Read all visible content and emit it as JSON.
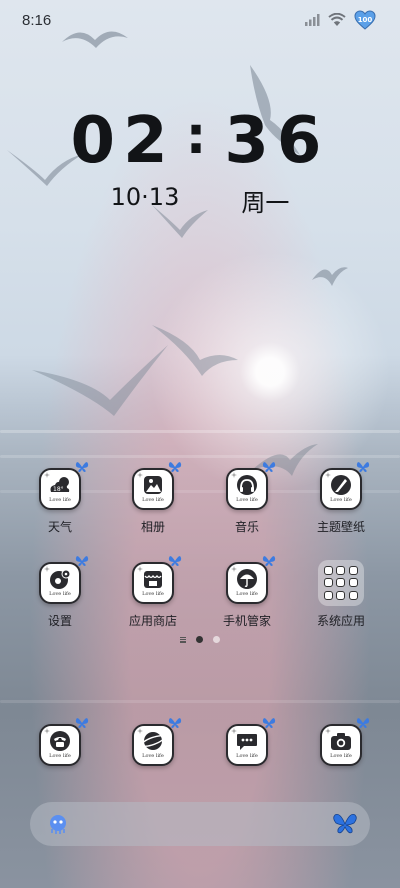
{
  "status_bar": {
    "time": "8:16",
    "battery_level": "100",
    "icons": [
      "signal-icon",
      "wifi-icon",
      "battery-heart-icon"
    ]
  },
  "clock": {
    "hours": "02",
    "separator": ":",
    "minutes": "36"
  },
  "date": {
    "day": "10·13",
    "weekday": "周一"
  },
  "icon_caption": "Love life",
  "apps": [
    {
      "label": "天气",
      "icon": "weather-icon"
    },
    {
      "label": "相册",
      "icon": "gallery-icon"
    },
    {
      "label": "音乐",
      "icon": "music-icon"
    },
    {
      "label": "主题壁纸",
      "icon": "theme-icon"
    },
    {
      "label": "设置",
      "icon": "settings-icon"
    },
    {
      "label": "应用商店",
      "icon": "app-store-icon"
    },
    {
      "label": "手机管家",
      "icon": "phone-manager-icon"
    },
    {
      "label": "系统应用",
      "icon": "folder-icon"
    }
  ],
  "weather_icon_temp": "18°",
  "dock": [
    {
      "icon": "phone-icon"
    },
    {
      "icon": "browser-icon"
    },
    {
      "icon": "messages-icon"
    },
    {
      "icon": "camera-icon"
    }
  ],
  "page_indicator": {
    "pages": 2,
    "active": 1
  },
  "search_bar": {
    "left_icon": "assistant-icon",
    "right_icon": "butterfly-icon"
  },
  "colors": {
    "icon_border": "#2a2a2e",
    "butterfly": "#3d7be0",
    "text": "#121417"
  }
}
